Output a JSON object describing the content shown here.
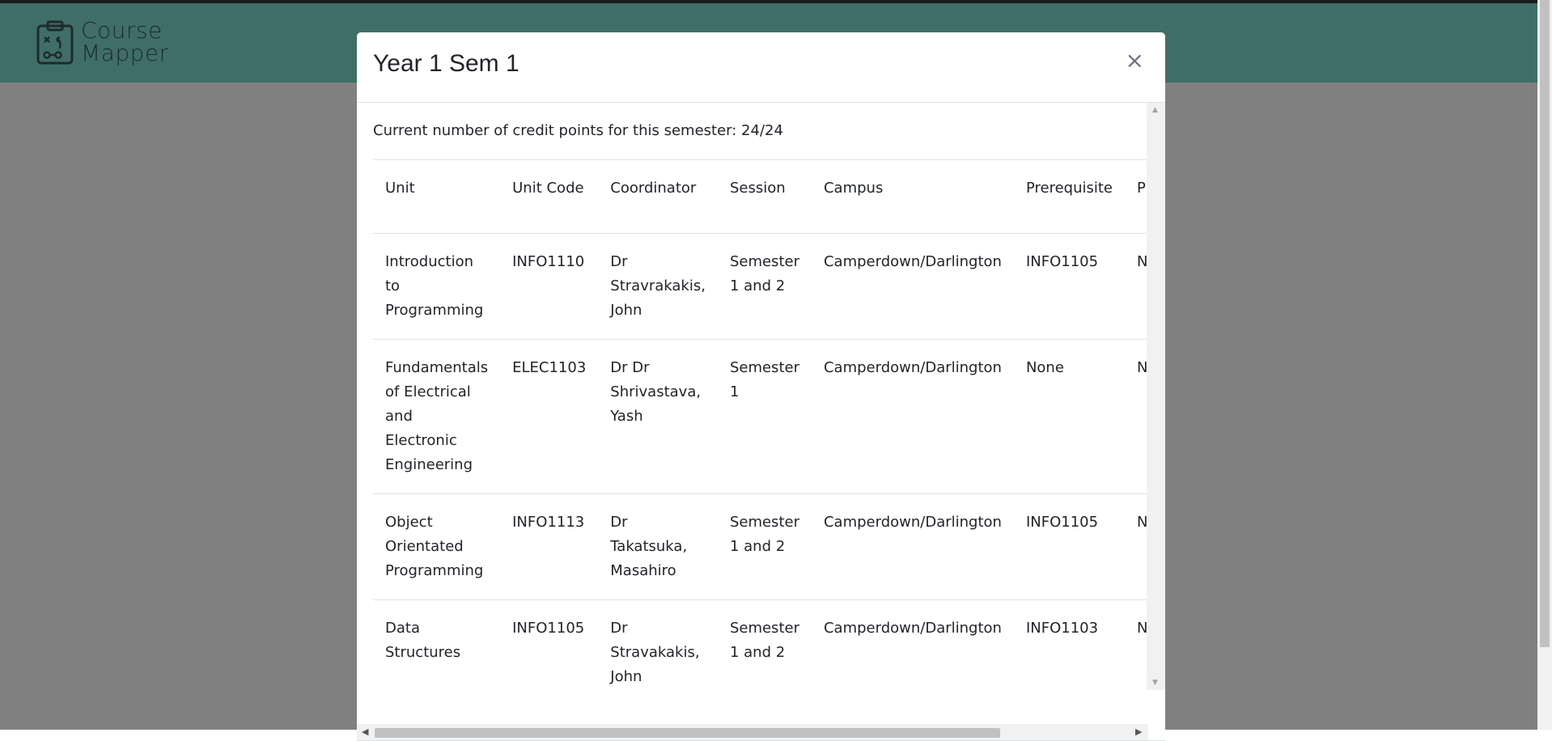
{
  "app": {
    "logo_line1": "Course",
    "logo_line2": "Mapper"
  },
  "modal": {
    "title": "Year 1 Sem 1",
    "close_label": "×",
    "credits_text": "Current number of credit points for this semester: 24/24"
  },
  "table": {
    "headers": {
      "unit": "Unit",
      "code": "Unit Code",
      "coordinator": "Coordinator",
      "session": "Session",
      "campus": "Campus",
      "prerequisite": "Prerequisite",
      "prohibition": "Prol"
    },
    "rows": [
      {
        "unit": "Introduction to Programming",
        "code": "INFO1110",
        "coordinator": "Dr Stravrakakis, John",
        "session": "Semester 1 and 2",
        "campus": "Camperdown/Darlington",
        "prerequisite": "INFO1105",
        "prohibition": "Nor"
      },
      {
        "unit": "Fundamentals of Electrical and Electronic Engineering",
        "code": "ELEC1103",
        "coordinator": "Dr Dr Shrivastava, Yash",
        "session": "Semester 1",
        "campus": "Camperdown/Darlington",
        "prerequisite": "None",
        "prohibition": "Nor"
      },
      {
        "unit": "Object Orientated Programming",
        "code": "INFO1113",
        "coordinator": "Dr Takatsuka, Masahiro",
        "session": "Semester 1 and 2",
        "campus": "Camperdown/Darlington",
        "prerequisite": "INFO1105",
        "prohibition": "Nor"
      },
      {
        "unit": "Data Structures",
        "code": "INFO1105",
        "coordinator": "Dr Stravakakis, John",
        "session": "Semester 1 and 2",
        "campus": "Camperdown/Darlington",
        "prerequisite": "INFO1103",
        "prohibition": "Nor"
      }
    ]
  },
  "icons": {
    "logo": "clipboard-strategy-icon",
    "close": "close-icon",
    "scroll_up": "scroll-up-arrow-icon",
    "scroll_down": "scroll-down-arrow-icon",
    "scroll_left": "scroll-left-arrow-icon",
    "scroll_right": "scroll-right-arrow-icon"
  },
  "colors": {
    "navbar": "#3f6e68",
    "backdrop": "#808080",
    "border": "#dee2e6",
    "text": "#212529"
  }
}
